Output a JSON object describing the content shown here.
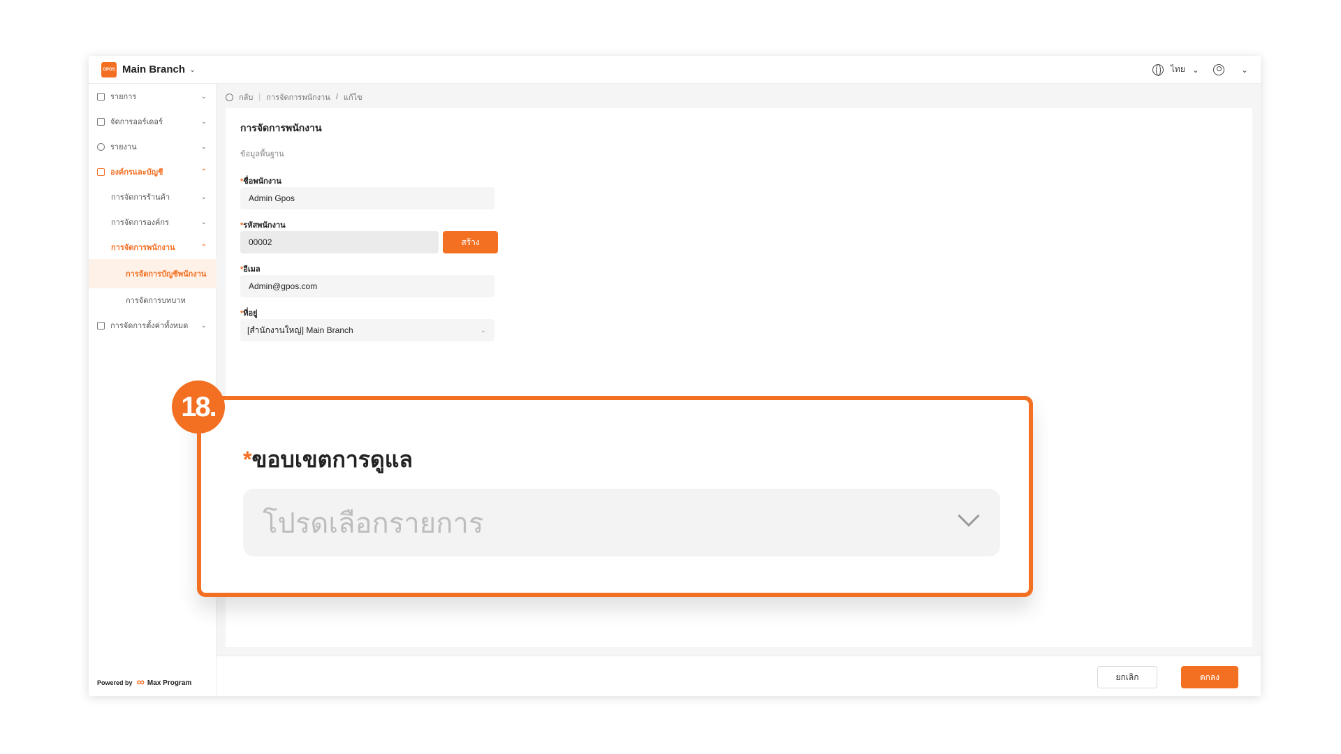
{
  "topbar": {
    "logo_text": "GPOS",
    "branch": "Main Branch",
    "language": "ไทย"
  },
  "sidebar": {
    "items": [
      {
        "label": "รายการ"
      },
      {
        "label": "จัดการออร์เดอร์"
      },
      {
        "label": "รายงาน"
      },
      {
        "label": "องค์กรและบัญชี"
      },
      {
        "label": "การจัดการร้านค้า"
      },
      {
        "label": "การจัดการองค์กร"
      },
      {
        "label": "การจัดการพนักงาน"
      },
      {
        "label": "การจัดการบัญชีพนักงาน"
      },
      {
        "label": "การจัดการบทบาท"
      },
      {
        "label": "การจัดการตั้งค่าทั้งหมด"
      }
    ],
    "powered_by": "Powered by",
    "brand": "Max Program"
  },
  "breadcrumb": {
    "back": "กลับ",
    "path": "การจัดการพนักงาน",
    "current": "แก้ไข"
  },
  "form": {
    "title": "การจัดการพนักงาน",
    "section": "ข้อมูลพื้นฐาน",
    "name_label": "ชื่อพนักงาน",
    "name_value": "Admin Gpos",
    "code_label": "รหัสพนักงาน",
    "code_value": "00002",
    "create_button": "สร้าง",
    "email_label": "อีเมล",
    "email_value": "Admin@gpos.com",
    "address_label": "ที่อยู่",
    "address_value": "[สำนักงานใหญ่] Main Branch"
  },
  "footer": {
    "cancel": "ยกเลิก",
    "ok": "ตกลง"
  },
  "callout": {
    "step": "18.",
    "label": "ขอบเขตการดูแล",
    "placeholder": "โปรดเลือกรายการ"
  },
  "colors": {
    "accent": "#f36f21"
  }
}
